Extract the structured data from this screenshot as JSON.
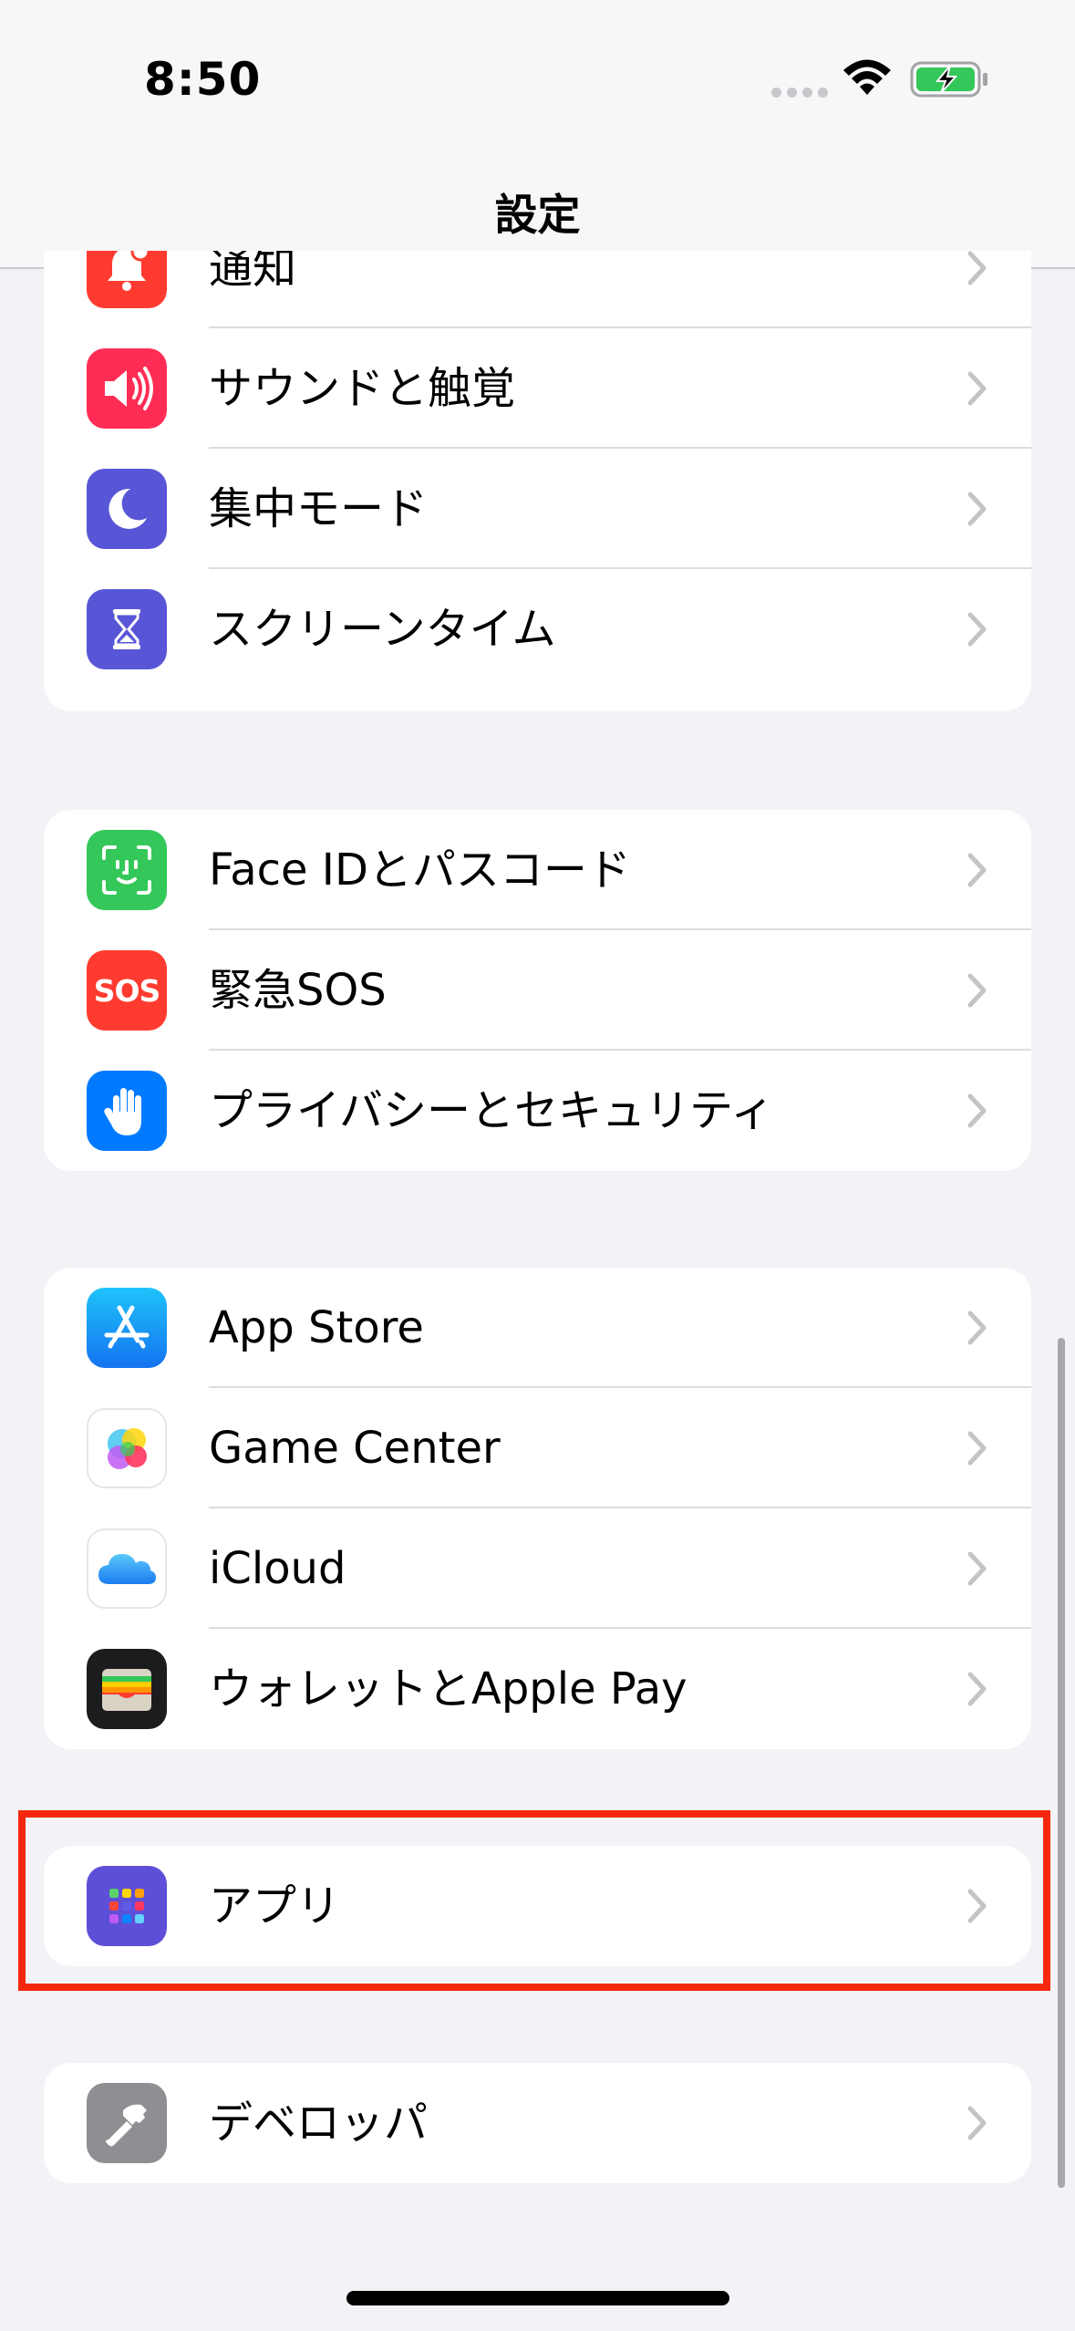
{
  "status_bar": {
    "time": "8:50"
  },
  "nav": {
    "title": "設定"
  },
  "groups": [
    {
      "items": [
        {
          "label": "通知",
          "icon": "bell-icon",
          "color": "#ff3b30"
        },
        {
          "label": "サウンドと触覚",
          "icon": "speaker-icon",
          "color": "#ff2d55"
        },
        {
          "label": "集中モード",
          "icon": "moon-icon",
          "color": "#5856d6"
        },
        {
          "label": "スクリーンタイム",
          "icon": "hourglass-icon",
          "color": "#5856d6"
        }
      ]
    },
    {
      "items": [
        {
          "label": "Face IDとパスコード",
          "icon": "face-id-icon",
          "color": "#34c759"
        },
        {
          "label": "緊急SOS",
          "icon": "sos-icon",
          "icon_text": "SOS",
          "color": "#ff3b30"
        },
        {
          "label": "プライバシーとセキュリティ",
          "icon": "hand-icon",
          "color": "#007aff"
        }
      ]
    },
    {
      "items": [
        {
          "label": "App Store",
          "icon": "app-store-icon",
          "color": "#0d84ff"
        },
        {
          "label": "Game Center",
          "icon": "game-center-icon",
          "color": "#ffffff"
        },
        {
          "label": "iCloud",
          "icon": "icloud-icon",
          "color": "#ffffff"
        },
        {
          "label": "ウォレットとApple Pay",
          "icon": "wallet-icon",
          "color": "#1c1c1e"
        }
      ]
    },
    {
      "items": [
        {
          "label": "アプリ",
          "icon": "apps-grid-icon",
          "color": "#5e4fd8"
        }
      ]
    },
    {
      "items": [
        {
          "label": "デベロッパ",
          "icon": "hammer-icon",
          "color": "#8e8e93"
        }
      ]
    }
  ]
}
